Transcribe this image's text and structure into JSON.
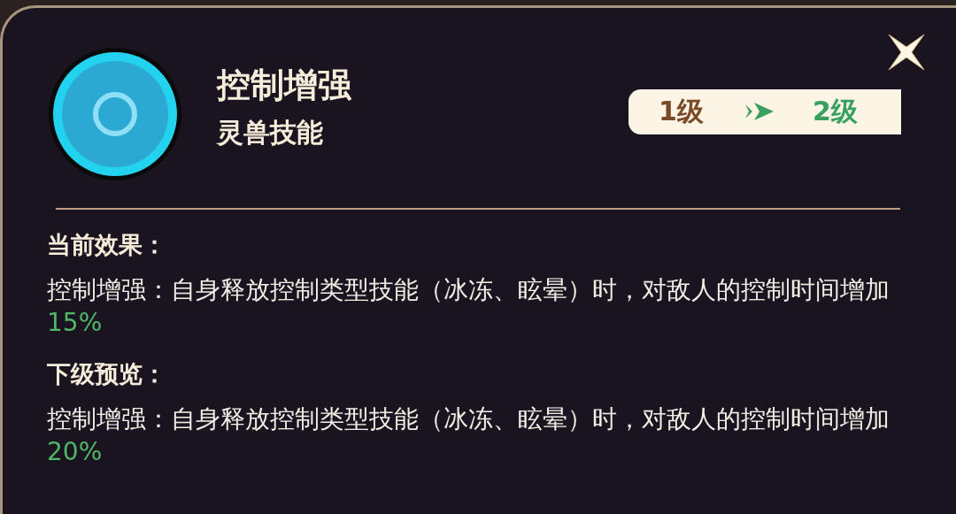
{
  "skill": {
    "name": "控制增强",
    "type": "灵兽技能"
  },
  "level_badge": {
    "from": "1级",
    "to": "2级"
  },
  "sections": [
    {
      "heading": "当前效果：",
      "text": "控制增强：自身释放控制类型技能（冰冻、眩晕）时，对敌人的控制时间增加",
      "value": "15%"
    },
    {
      "heading": "下级预览：",
      "text": "控制增强：自身释放控制类型技能（冰冻、眩晕）时，对敌人的控制时间增加",
      "value": "20%"
    }
  ]
}
